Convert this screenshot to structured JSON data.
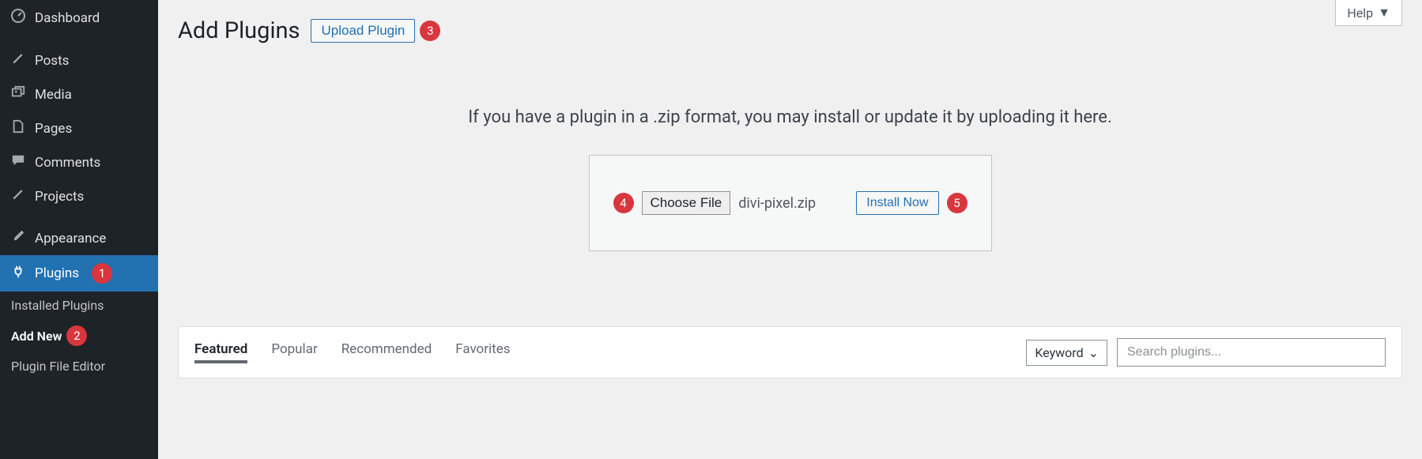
{
  "sidebar": {
    "dashboard": "Dashboard",
    "posts": "Posts",
    "media": "Media",
    "pages": "Pages",
    "comments": "Comments",
    "projects": "Projects",
    "appearance": "Appearance",
    "plugins": "Plugins",
    "submenu": {
      "installed": "Installed Plugins",
      "add_new": "Add New",
      "editor": "Plugin File Editor"
    }
  },
  "header": {
    "title": "Add Plugins",
    "upload_button": "Upload Plugin",
    "help": "Help"
  },
  "upload": {
    "info": "If you have a plugin in a .zip format, you may install or update it by uploading it here.",
    "choose": "Choose File",
    "file_name": "divi-pixel.zip",
    "install": "Install Now"
  },
  "tabs": {
    "featured": "Featured",
    "popular": "Popular",
    "recommended": "Recommended",
    "favorites": "Favorites"
  },
  "search": {
    "keyword": "Keyword",
    "placeholder": "Search plugins..."
  },
  "steps": {
    "s1": "1",
    "s2": "2",
    "s3": "3",
    "s4": "4",
    "s5": "5"
  }
}
